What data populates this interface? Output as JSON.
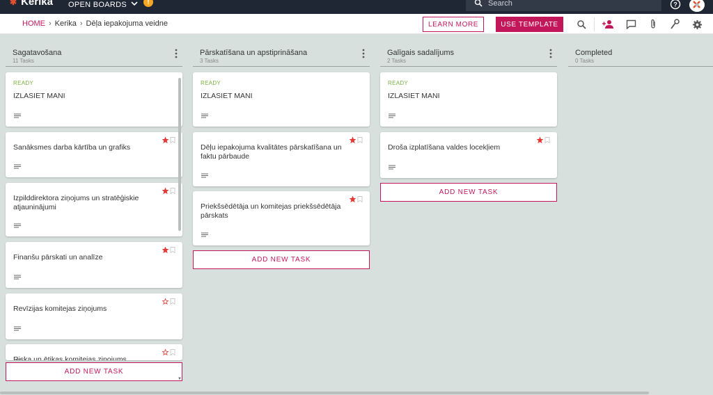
{
  "topbar": {
    "logo_text": "Kerika",
    "boards_label": "OPEN BOARDS",
    "notification_count": "!",
    "search_placeholder": "Search"
  },
  "breadcrumb": {
    "home": "HOME",
    "items": [
      "Kerika",
      "Dēļa iepakojuma veidne"
    ]
  },
  "actions": {
    "learn_more": "LEARN MORE",
    "use_template": "USE TEMPLATE"
  },
  "toolbar_icons": [
    "search-icon",
    "add-person-icon",
    "chat-icon",
    "attachment-icon",
    "key-icon",
    "gear-icon"
  ],
  "colors": {
    "accent": "#c2185b",
    "ready": "#7cb342",
    "star": "#e53935",
    "background": "#d7e0dd",
    "topbar": "#1f2735"
  },
  "columns": [
    {
      "title": "Sagatavošana",
      "count": "11 Tasks",
      "cards": [
        {
          "status": "READY",
          "title": "IZLASIET MANI",
          "star": "none"
        },
        {
          "status": "",
          "title": "Sanāksmes darba kārtība un grafiks",
          "star": "filled"
        },
        {
          "status": "",
          "title": "Izpilddirektora ziņojums un stratēģiskie atjauninājumi",
          "star": "filled"
        },
        {
          "status": "",
          "title": "Finanšu pārskati un analīze",
          "star": "filled"
        },
        {
          "status": "",
          "title": "Revīzijas komitejas ziņojums",
          "star": "outline"
        },
        {
          "status": "",
          "title": "Riska un ētikas komitejas ziņojums",
          "star": "outline"
        }
      ],
      "add_task": "ADD NEW TASK"
    },
    {
      "title": "Pārskatīšana un apstiprināšana",
      "count": "3 Tasks",
      "cards": [
        {
          "status": "READY",
          "title": "IZLASIET MANI",
          "star": "none"
        },
        {
          "status": "",
          "title": "Dēļu iepakojuma kvalitātes pārskatīšana un faktu pārbaude",
          "star": "filled"
        },
        {
          "status": "",
          "title": "Priekšsēdētāja un komitejas priekšsēdētāja pārskats",
          "star": "filled"
        }
      ],
      "add_task": "ADD NEW TASK"
    },
    {
      "title": "Galīgais sadalījums",
      "count": "2 Tasks",
      "cards": [
        {
          "status": "READY",
          "title": "IZLASIET MANI",
          "star": "none"
        },
        {
          "status": "",
          "title": "Droša izplatīšana valdes locekļiem",
          "star": "filled"
        }
      ],
      "add_task": "ADD NEW TASK"
    },
    {
      "title": "Completed",
      "count": "0 Tasks",
      "cards": [],
      "add_task": ""
    }
  ]
}
